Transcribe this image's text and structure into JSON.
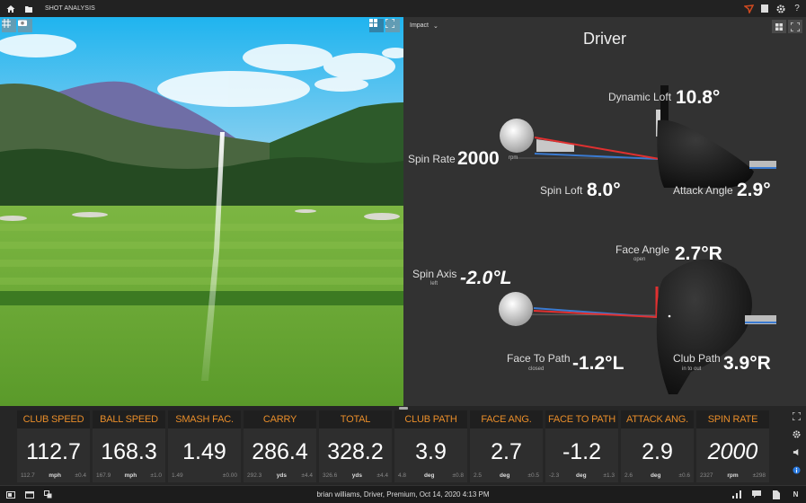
{
  "topbar": {
    "title": "SHOT ANALYSIS",
    "left_icons": [
      "home-icon",
      "folder-icon"
    ],
    "right_icons": [
      "logo-icon",
      "tablet-icon",
      "gear-icon",
      "help-icon"
    ],
    "help_glyph": "?"
  },
  "view": {
    "buttons_left": [
      "grid-icon",
      "camera-icon"
    ],
    "buttons_right": [
      "layout-icon",
      "fullscreen-icon"
    ]
  },
  "panel": {
    "dropdown": {
      "selected": "Impact",
      "chevron": "⌄"
    },
    "club": "Driver",
    "side_view": {
      "dynamic_loft": {
        "label": "Dynamic Loft",
        "value": "10.8°"
      },
      "spin_rate": {
        "label": "Spin Rate",
        "value": "2000",
        "unit": "rpm"
      },
      "spin_loft": {
        "label": "Spin Loft",
        "value": "8.0°"
      },
      "attack_angle": {
        "label": "Attack Angle",
        "value": "2.9°"
      }
    },
    "top_view": {
      "face_angle": {
        "label": "Face Angle",
        "sub": "open",
        "value": "2.7°R"
      },
      "spin_axis": {
        "label": "Spin Axis",
        "sub": "left",
        "value": "-2.0°L"
      },
      "face_to_path": {
        "label": "Face To Path",
        "sub": "closed",
        "value": "-1.2°L"
      },
      "club_path": {
        "label": "Club Path",
        "sub": "in to out",
        "value": "3.9°R"
      }
    }
  },
  "metrics": [
    {
      "title": "CLUB SPEED",
      "value": "112.7",
      "avg": "112.7",
      "unit": "mph",
      "dev": "±0.4"
    },
    {
      "title": "BALL SPEED",
      "value": "168.3",
      "avg": "167.9",
      "unit": "mph",
      "dev": "±1.0"
    },
    {
      "title": "SMASH FAC.",
      "value": "1.49",
      "avg": "1.49",
      "unit": "",
      "dev": "±0.00"
    },
    {
      "title": "CARRY",
      "value": "286.4",
      "avg": "292.3",
      "unit": "yds",
      "dev": "±4.4"
    },
    {
      "title": "TOTAL",
      "value": "328.2",
      "avg": "326.6",
      "unit": "yds",
      "dev": "±4.4"
    },
    {
      "title": "CLUB PATH",
      "value": "3.9",
      "avg": "4.8",
      "unit": "deg",
      "dev": "±0.8"
    },
    {
      "title": "FACE ANG.",
      "value": "2.7",
      "avg": "2.5",
      "unit": "deg",
      "dev": "±0.5"
    },
    {
      "title": "FACE TO PATH",
      "value": "-1.2",
      "avg": "-2.3",
      "unit": "deg",
      "dev": "±1.3"
    },
    {
      "title": "ATTACK ANG.",
      "value": "2.9",
      "avg": "2.6",
      "unit": "deg",
      "dev": "±0.6"
    },
    {
      "title": "SPIN RATE",
      "value": "2000",
      "avg": "2327",
      "unit": "rpm",
      "dev": "±298"
    }
  ],
  "side_icons": [
    "fullscreen-icon",
    "gear-icon",
    "speaker-icon",
    "info-icon"
  ],
  "status": {
    "text": "brian williams, Driver, Premium, Oct 14, 2020 4:13 PM",
    "left_icons": [
      "panel-icon",
      "window-icon",
      "copy-icon"
    ],
    "right_icons": [
      "chart-icon",
      "comment-icon",
      "document-icon"
    ],
    "right_letter": "N"
  },
  "colors": {
    "accent": "#e88d2a",
    "panel": "#323232",
    "red_line": "#e03030",
    "blue_line": "#3a7ad0"
  }
}
